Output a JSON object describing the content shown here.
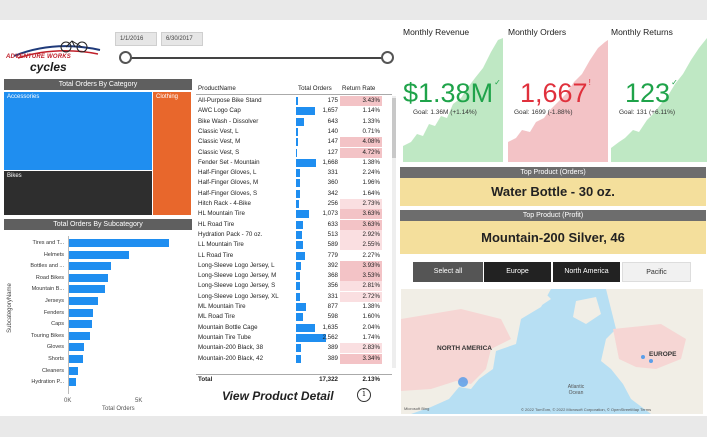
{
  "logo": {
    "line1": "ADVENTURE WORKS",
    "line2": "cycles"
  },
  "date_filter": {
    "start": "1/1/2016",
    "end": "6/30/2017"
  },
  "treemap": {
    "title": "Total Orders By Category",
    "cells": [
      {
        "label": "Accessories",
        "color": "#1f8ef0"
      },
      {
        "label": "Clothing",
        "color": "#e8672c"
      },
      {
        "label": "Bikes",
        "color": "#2e2e2e"
      }
    ]
  },
  "subcategory": {
    "title": "Total Orders By Subcategory",
    "ylabel": "SubcategoryName",
    "xlabel": "Total Orders",
    "tick_labels": [
      "0K",
      "5K"
    ]
  },
  "product_table": {
    "headers": [
      "ProductName",
      "Total Orders",
      "Return Rate"
    ],
    "rows": [
      {
        "name": "All-Purpose Bike Stand",
        "orders": "175",
        "rate": "3.43%",
        "level": "hi"
      },
      {
        "name": "AWC Logo Cap",
        "orders": "1,657",
        "rate": "1.14%",
        "level": ""
      },
      {
        "name": "Bike Wash - Dissolver",
        "orders": "643",
        "rate": "1.33%",
        "level": ""
      },
      {
        "name": "Classic Vest, L",
        "orders": "140",
        "rate": "0.71%",
        "level": ""
      },
      {
        "name": "Classic Vest, M",
        "orders": "147",
        "rate": "4.08%",
        "level": "hi"
      },
      {
        "name": "Classic Vest, S",
        "orders": "127",
        "rate": "4.72%",
        "level": "hi"
      },
      {
        "name": "Fender Set - Mountain",
        "orders": "1,668",
        "rate": "1.38%",
        "level": ""
      },
      {
        "name": "Half-Finger Gloves, L",
        "orders": "331",
        "rate": "2.24%",
        "level": ""
      },
      {
        "name": "Half-Finger Gloves, M",
        "orders": "360",
        "rate": "1.96%",
        "level": ""
      },
      {
        "name": "Half-Finger Gloves, S",
        "orders": "342",
        "rate": "1.64%",
        "level": ""
      },
      {
        "name": "Hitch Rack - 4-Bike",
        "orders": "256",
        "rate": "2.73%",
        "level": "mid"
      },
      {
        "name": "HL Mountain Tire",
        "orders": "1,073",
        "rate": "3.63%",
        "level": "hi"
      },
      {
        "name": "HL Road Tire",
        "orders": "633",
        "rate": "3.63%",
        "level": "hi"
      },
      {
        "name": "Hydration Pack - 70 oz.",
        "orders": "513",
        "rate": "2.92%",
        "level": "mid"
      },
      {
        "name": "LL Mountain Tire",
        "orders": "589",
        "rate": "2.55%",
        "level": "mid"
      },
      {
        "name": "LL Road Tire",
        "orders": "779",
        "rate": "2.27%",
        "level": ""
      },
      {
        "name": "Long-Sleeve Logo Jersey, L",
        "orders": "392",
        "rate": "3.93%",
        "level": "hi"
      },
      {
        "name": "Long-Sleeve Logo Jersey, M",
        "orders": "368",
        "rate": "3.53%",
        "level": "hi"
      },
      {
        "name": "Long-Sleeve Logo Jersey, S",
        "orders": "356",
        "rate": "2.81%",
        "level": "mid"
      },
      {
        "name": "Long-Sleeve Logo Jersey, XL",
        "orders": "331",
        "rate": "2.72%",
        "level": "mid"
      },
      {
        "name": "ML Mountain Tire",
        "orders": "877",
        "rate": "1.38%",
        "level": ""
      },
      {
        "name": "ML Road Tire",
        "orders": "598",
        "rate": "1.60%",
        "level": ""
      },
      {
        "name": "Mountain Bottle Cage",
        "orders": "1,635",
        "rate": "2.04%",
        "level": ""
      },
      {
        "name": "Mountain Tire Tube",
        "orders": "2,562",
        "rate": "1.74%",
        "level": ""
      },
      {
        "name": "Mountain-200 Black, 38",
        "orders": "389",
        "rate": "2.83%",
        "level": "mid"
      },
      {
        "name": "Mountain-200 Black, 42",
        "orders": "389",
        "rate": "3.34%",
        "level": "hi"
      }
    ],
    "total": {
      "name": "Total",
      "orders": "17,322",
      "rate": "2.13%"
    }
  },
  "view_detail": "View Product Detail",
  "kpis": [
    {
      "title": "Monthly Revenue",
      "value": "$1.38M",
      "goal": "Goal: 1.36M (+1.14%)",
      "color": "#1fa34a",
      "mark": "✓"
    },
    {
      "title": "Monthly Orders",
      "value": "1,667",
      "goal": "Goal: 1699 (-1.88%)",
      "color": "#e0303c",
      "mark": "!"
    },
    {
      "title": "Monthly Returns",
      "value": "123",
      "goal": "Goal: 131 (+6.11%)",
      "color": "#1fa34a",
      "mark": "✓"
    }
  ],
  "top_product_orders": {
    "title": "Top Product (Orders)",
    "value": "Water Bottle - 30 oz."
  },
  "top_product_profit": {
    "title": "Top Product (Profit)",
    "value": "Mountain-200 Silver, 46"
  },
  "regions": [
    "Select all",
    "Europe",
    "North America",
    "Pacific"
  ],
  "map": {
    "label_na": "NORTH AMERICA",
    "label_eu": "EUROPE",
    "label_ocean": "Atlantic Ocean",
    "attribution_left": "Microsoft Bing",
    "attribution_right": "© 2022 TomTom, © 2022 Microsoft Corporation, © OpenStreetMap  Terms"
  },
  "subcategory_chart": {
    "type": "bar",
    "categories": [
      "Tires and T...",
      "Helmets",
      "Bottles and ...",
      "Road Bikes",
      "Mountain B...",
      "Jerseys",
      "Fenders",
      "Caps",
      "Touring Bikes",
      "Gloves",
      "Shorts",
      "Cleaners",
      "Hydration P..."
    ],
    "values": [
      7200,
      4300,
      3000,
      2800,
      2600,
      2100,
      1700,
      1650,
      1500,
      1050,
      1000,
      680,
      500
    ],
    "xlabel": "Total Orders",
    "ylabel": "SubcategoryName",
    "xlim": [
      0,
      7500
    ]
  }
}
